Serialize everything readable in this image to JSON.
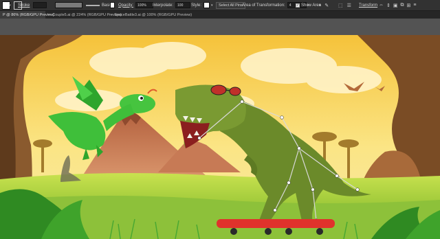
{
  "controlbar": {
    "stroke_label": "Stroke",
    "brush_label": "Basic",
    "opacity_label": "Opacity:",
    "opacity_value": "100%",
    "interpolate_label": "Interpolate:",
    "interpolate_value": "100",
    "style_label": "Style:",
    "select_all_pins": "Select All Pins",
    "area_label": "Area of Transformation:",
    "area_value": "4",
    "show_area_label": "Show Area",
    "show_area_checked": "✓",
    "transform_label": "Transform",
    "fill_color": "#ffffff"
  },
  "tabs": [
    {
      "label": "P @ 86% (RGB/GPU Preview)",
      "active": true
    },
    {
      "label": "Couple5.ai @ 224% (RGB/GPU Preview)",
      "active": false
    },
    {
      "label": "SpaceBattle3.ai @ 100% (RGB/GPU Preview)",
      "active": false
    }
  ],
  "artwork": {
    "sky_color": "#f7d64a",
    "ground_color": "#9acb2d",
    "trex_color": "#6b8a2a",
    "dragon_color": "#3fbf3a",
    "skateboard_color": "#e0322c"
  }
}
